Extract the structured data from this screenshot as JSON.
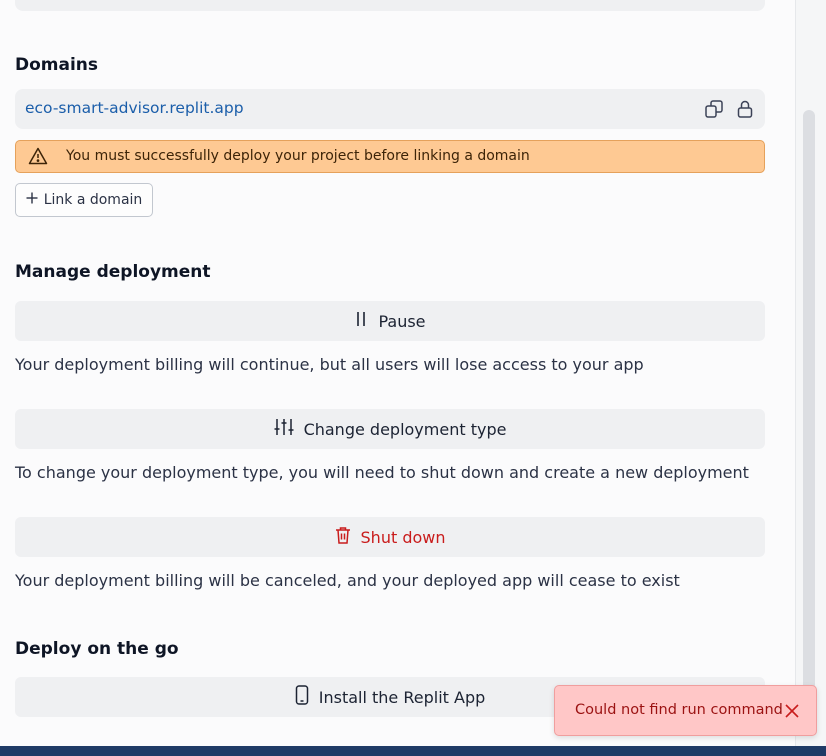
{
  "domains": {
    "title": "Domains",
    "url": "eco-smart-advisor.replit.app",
    "copy_icon": "copy-icon",
    "lock_icon": "lock-icon",
    "warning_icon": "warning-triangle-icon",
    "warning_text": "You must successfully deploy your project before linking a domain",
    "link_label": "Link a domain"
  },
  "manage": {
    "title": "Manage deployment",
    "pause_label": "Pause",
    "pause_desc": "Your deployment billing will continue, but all users will lose access to your app",
    "change_label": "Change deployment type",
    "change_desc": "To change your deployment type, you will need to shut down and create a new deployment",
    "shutdown_label": "Shut down",
    "shutdown_desc": "Your deployment billing will be canceled, and your deployed app will cease to exist"
  },
  "mobile": {
    "title": "Deploy on the go",
    "install_label": "Install the Replit App"
  },
  "toast": {
    "message": "Could not find run command"
  },
  "colors": {
    "link": "#1b5eaa",
    "warning_bg": "#fec993",
    "danger": "#c91c1c",
    "toast_bg": "#ffc7c7"
  }
}
